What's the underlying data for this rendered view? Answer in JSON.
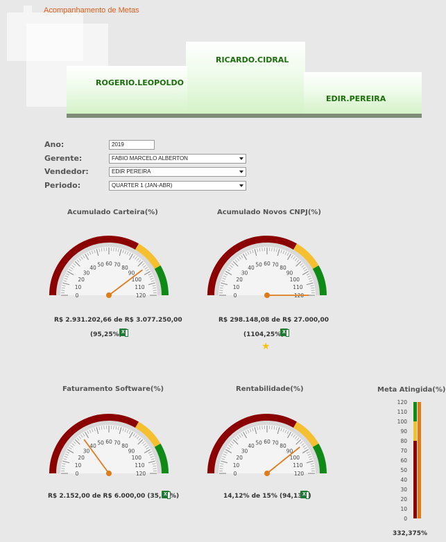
{
  "page": {
    "title": "Acompanhamento de Metas"
  },
  "podium": {
    "first": "RICARDO.CIDRAL",
    "second": "ROGERIO.LEOPOLDO",
    "third": "EDIR.PEREIRA"
  },
  "filters": {
    "ano": {
      "label": "Ano:",
      "value": "2019"
    },
    "gerente": {
      "label": "Gerente:",
      "value": "FABIO MARCELO ALBERTON"
    },
    "vendedor": {
      "label": "Vendedor:",
      "value": "EDIR PEREIRA"
    },
    "periodo": {
      "label": "Periodo:",
      "value": "QUARTER 1 (JAN-ABR)"
    }
  },
  "gauges": [
    {
      "title": "Acumulado Carteira(%)",
      "value": 95.25,
      "line1": "R$ 2.931.202,66 de R$ 3.077.250,00",
      "line2": "(95,25%)",
      "star": false
    },
    {
      "title": "Acumulado Novos CNPJ(%)",
      "value": 1104.25,
      "line1": "R$ 298.148,08 de R$ 27.000,00",
      "line2": "(1104,25%)",
      "star": true
    },
    {
      "title": "Faturamento Software(%)",
      "value": 35.87,
      "line1": "R$ 2.152,00 de R$ 6.000,00 (35,87%)",
      "line2": "",
      "star": false
    },
    {
      "title": "Rentabilidade(%)",
      "value": 94.13,
      "line1": "14,12% de 15% (94,13%)",
      "line2": "",
      "star": false
    }
  ],
  "gauge_scale": {
    "min": 0,
    "max": 120,
    "labels": [
      "0",
      "10",
      "20",
      "30",
      "40",
      "50",
      "60",
      "70",
      "80",
      "90",
      "100",
      "110",
      "120"
    ]
  },
  "colors": {
    "red_band": "#8b0000",
    "yellow_band": "#f5c030",
    "green_band": "#0f8a17",
    "needle": "#e07b1a",
    "accent": "#e25c1a"
  },
  "meta": {
    "title": "Meta Atingida(%)",
    "value_text": "332,375%",
    "value": 332.375,
    "labels": [
      "120",
      "110",
      "100",
      "90",
      "80",
      "70",
      "60",
      "50",
      "40",
      "30",
      "20",
      "10",
      "0"
    ]
  },
  "icons": {
    "export": "excel-icon",
    "highlight": "star-icon"
  }
}
